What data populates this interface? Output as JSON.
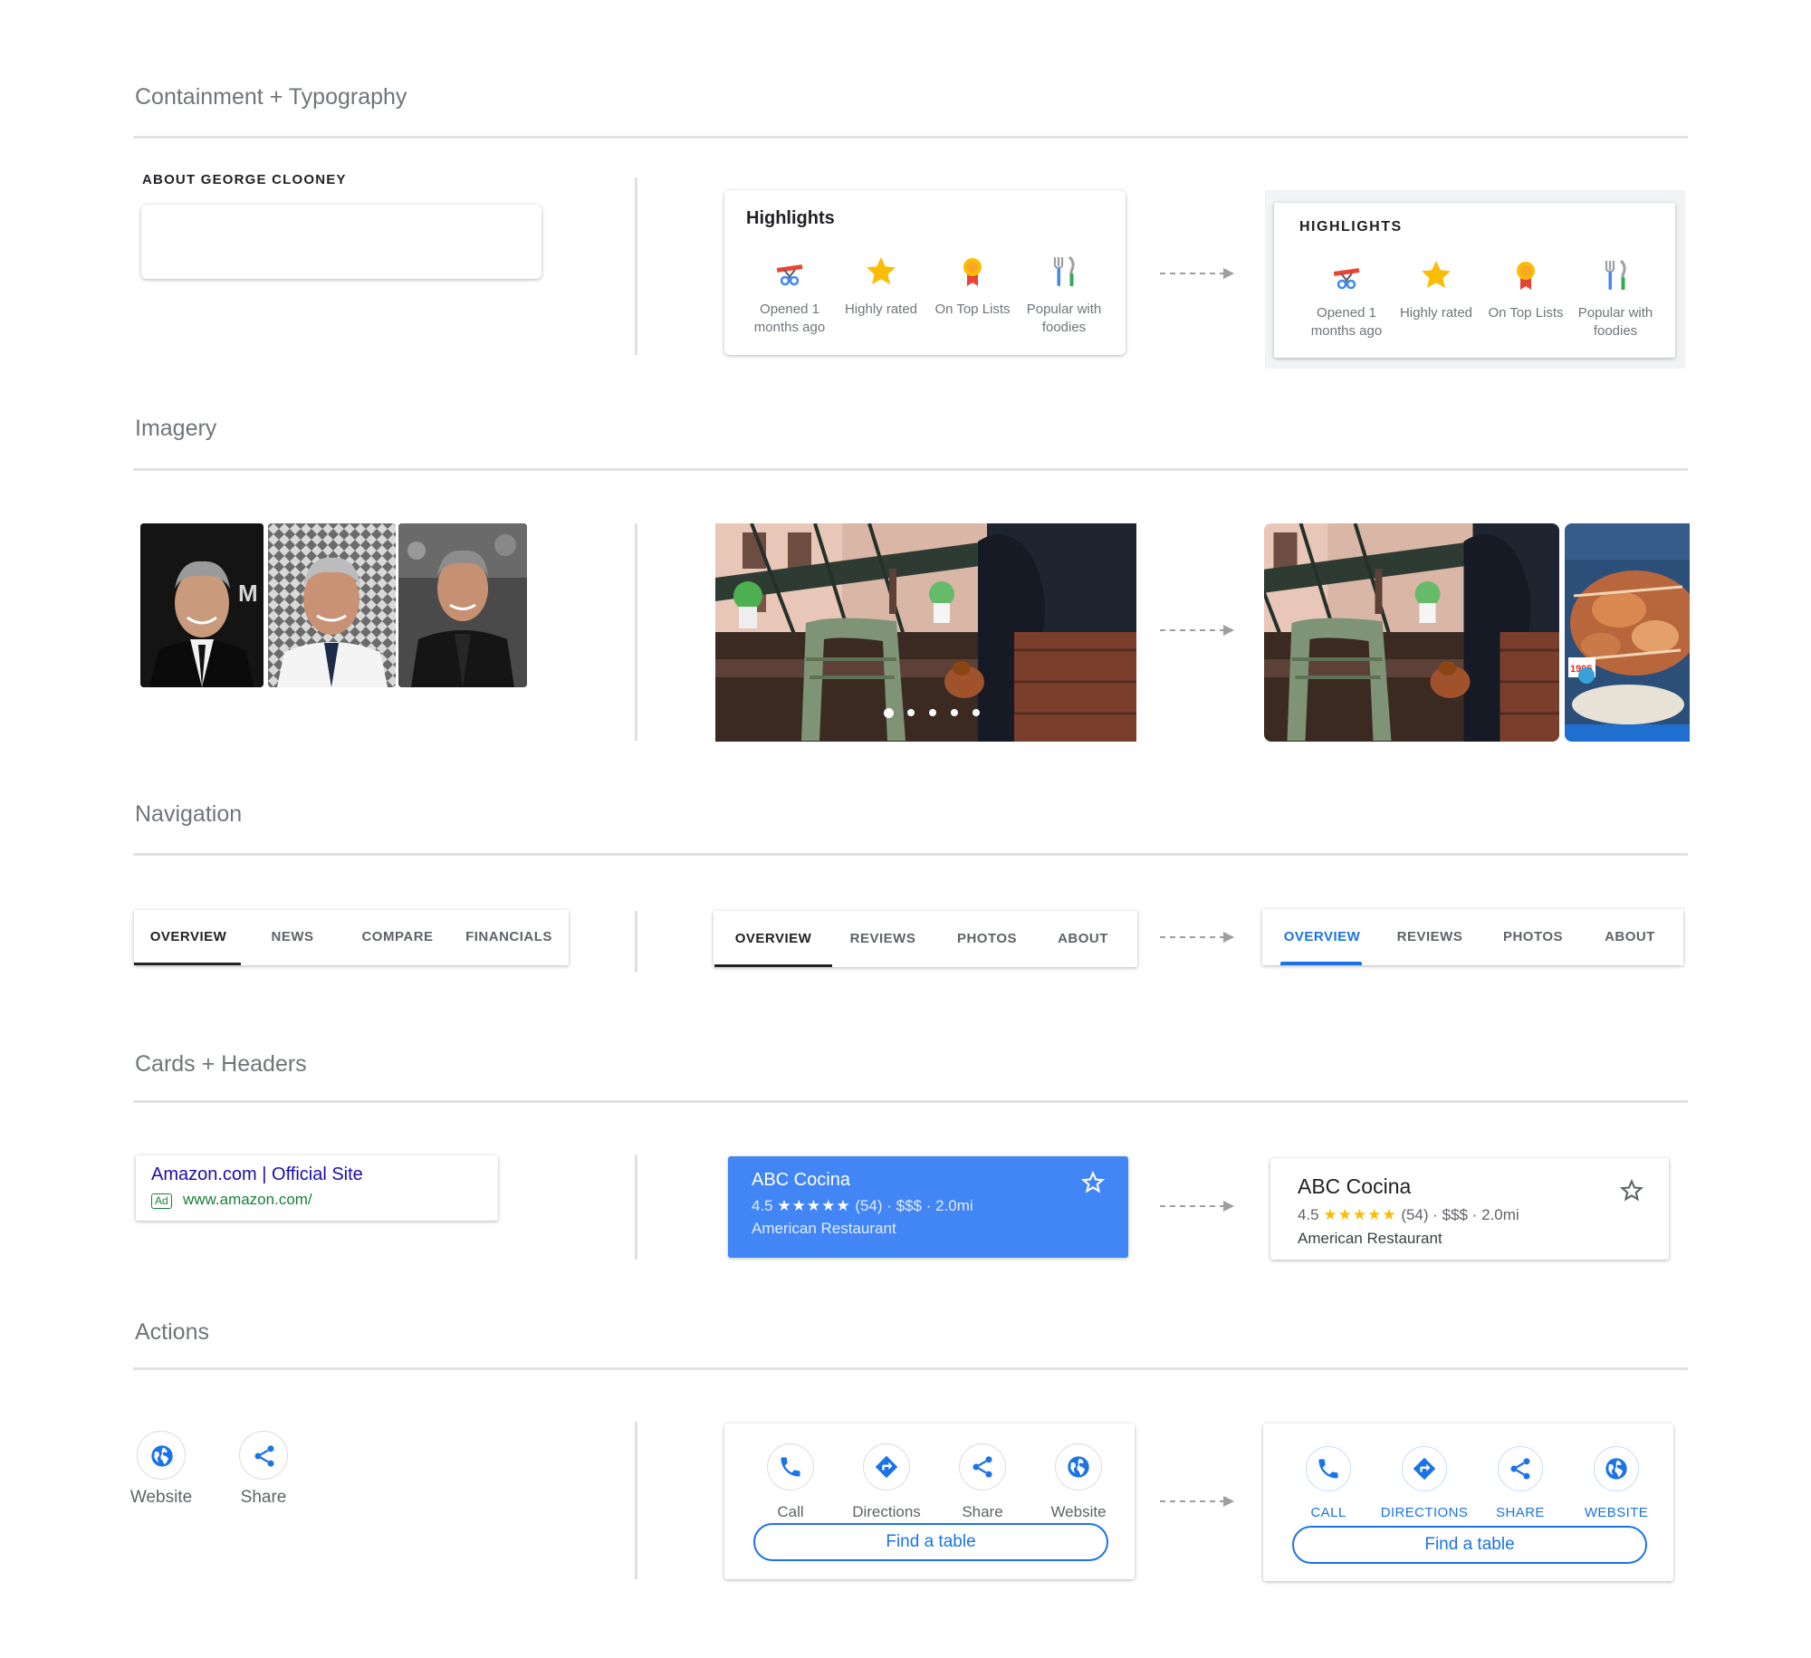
{
  "sections": {
    "containment": "Containment + Typography",
    "imagery": "Imagery",
    "navigation": "Navigation",
    "cards": "Cards + Headers",
    "actions": "Actions"
  },
  "about": {
    "title": "ABOUT GEORGE CLOONEY"
  },
  "highlights": {
    "title_old": "Highlights",
    "title_new": "HIGHLIGHTS",
    "items": [
      {
        "label": "Opened 1 months ago",
        "icon": "scissors-ribbon-icon"
      },
      {
        "label": "Highly rated",
        "icon": "star-icon"
      },
      {
        "label": "On Top Lists",
        "icon": "award-ribbon-icon"
      },
      {
        "label": "Popular with foodies",
        "icon": "utensils-icon"
      }
    ]
  },
  "tabs": {
    "stock": [
      "OVERVIEW",
      "NEWS",
      "COMPARE",
      "FINANCIALS"
    ],
    "place": [
      "OVERVIEW",
      "REVIEWS",
      "PHOTOS",
      "ABOUT"
    ]
  },
  "ad": {
    "title": "Amazon.com | Official Site",
    "badge": "Ad",
    "url": "www.amazon.com/"
  },
  "place_card": {
    "name": "ABC Cocina",
    "rating": "4.5",
    "stars": "★★★★★",
    "meta": "(54) · $$$ · 2.0mi",
    "category": "American Restaurant"
  },
  "actions": {
    "left": [
      "Website",
      "Share"
    ],
    "old": [
      "Call",
      "Directions",
      "Share",
      "Website"
    ],
    "new": [
      "CALL",
      "DIRECTIONS",
      "SHARE",
      "WEBSITE"
    ],
    "find_table": "Find a table"
  },
  "colors": {
    "blue": "#1a73e8",
    "card_blue": "#4285f4",
    "green": "#188038",
    "star": "#fbbc04"
  }
}
